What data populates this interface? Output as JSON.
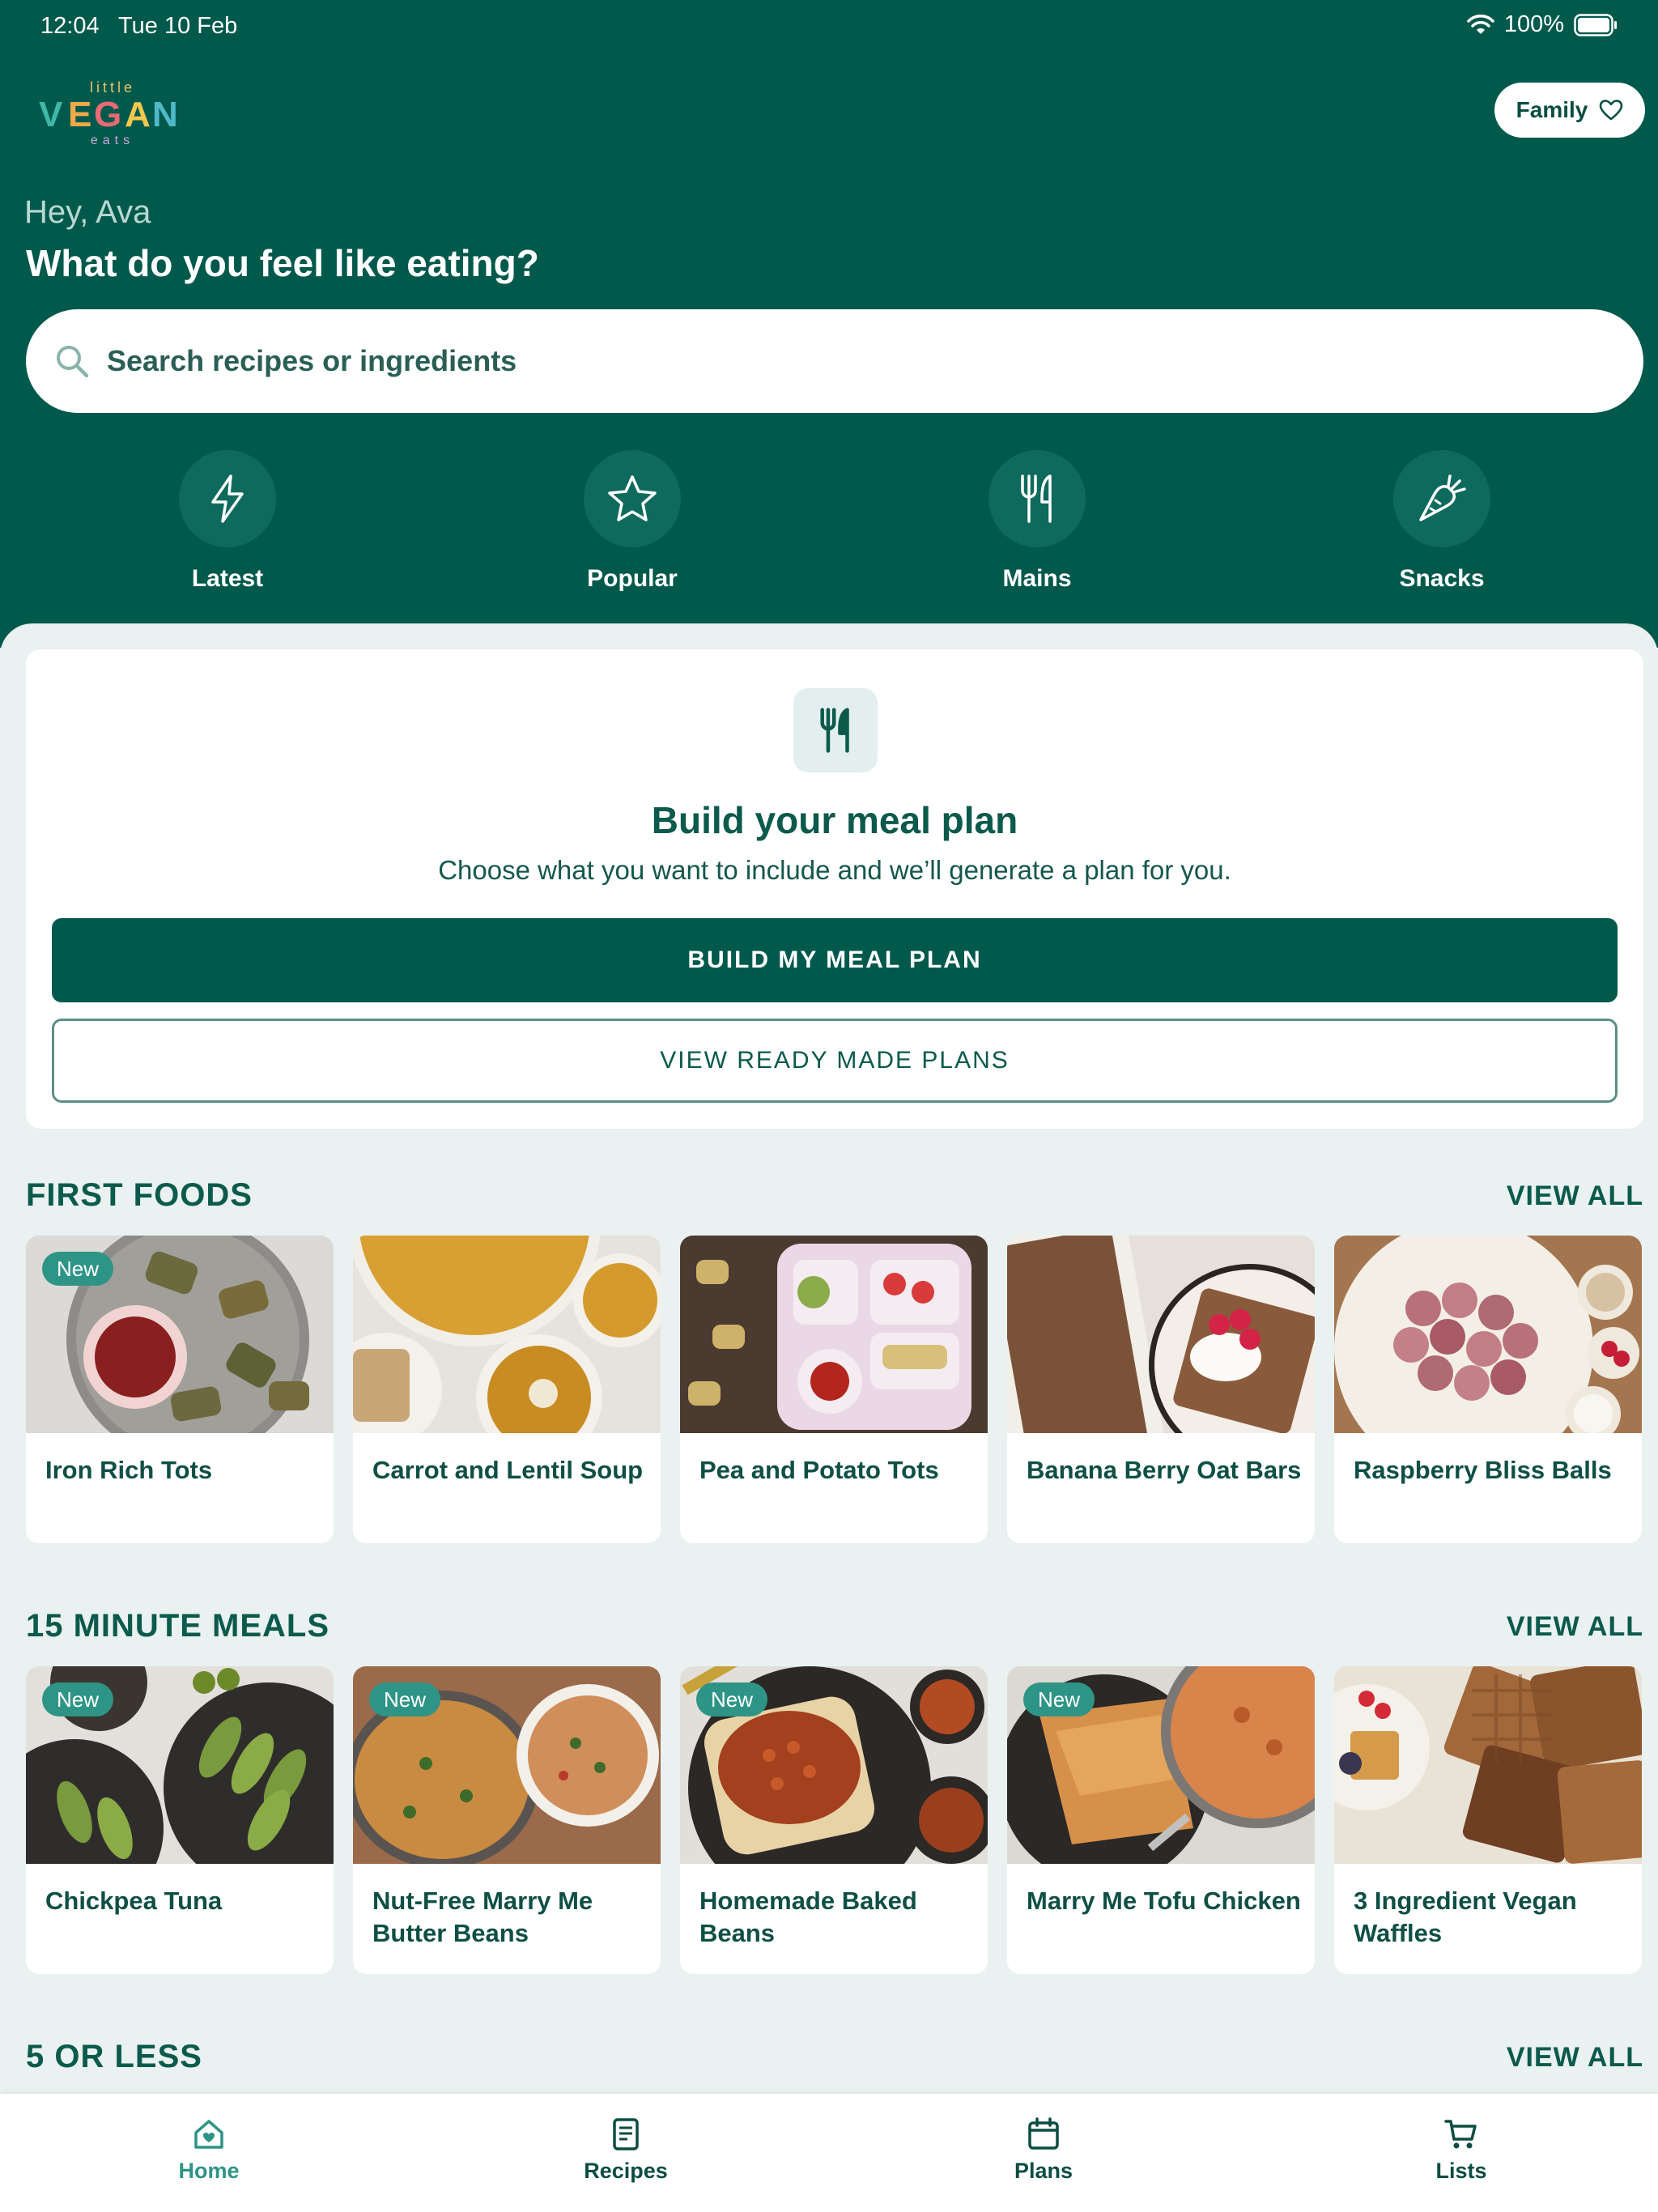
{
  "status_bar": {
    "time": "12:04",
    "date": "Tue 10 Feb",
    "battery": "100%"
  },
  "header": {
    "logo_text": [
      "little",
      "VEGAN",
      "eats"
    ],
    "profile_button": "Family",
    "greeting": "Hey, Ava",
    "question": "What do you feel like eating?"
  },
  "search": {
    "placeholder": "Search recipes or ingredients"
  },
  "categories": [
    {
      "label": "Latest",
      "icon": "bolt-icon"
    },
    {
      "label": "Popular",
      "icon": "star-icon"
    },
    {
      "label": "Mains",
      "icon": "cutlery-icon"
    },
    {
      "label": "Snacks",
      "icon": "carrot-icon"
    }
  ],
  "meal_plan": {
    "title": "Build your meal plan",
    "subtitle": "Choose what you want to include and we’ll generate a plan for you.",
    "primary_button": "BUILD MY MEAL PLAN",
    "secondary_button": "VIEW READY MADE PLANS"
  },
  "sections": [
    {
      "title": "FIRST FOODS",
      "view_all": "VIEW ALL",
      "items": [
        {
          "name": "Iron Rich Tots",
          "badge": "New"
        },
        {
          "name": "Carrot and Lentil Soup",
          "badge": ""
        },
        {
          "name": "Pea and Potato Tots",
          "badge": ""
        },
        {
          "name": "Banana Berry Oat Bars",
          "badge": ""
        },
        {
          "name": "Raspberry Bliss Balls",
          "badge": ""
        }
      ]
    },
    {
      "title": "15 MINUTE MEALS",
      "view_all": "VIEW ALL",
      "items": [
        {
          "name": "Chickpea Tuna",
          "badge": "New"
        },
        {
          "name": "Nut-Free Marry Me Butter Beans",
          "badge": "New"
        },
        {
          "name": "Homemade Baked Beans",
          "badge": "New"
        },
        {
          "name": "Marry Me Tofu Chicken",
          "badge": "New"
        },
        {
          "name": "3 Ingredient Vegan Waffles",
          "badge": ""
        }
      ]
    },
    {
      "title": "5 OR LESS",
      "view_all": "VIEW ALL",
      "items": []
    }
  ],
  "bottom_nav": [
    {
      "label": "Home",
      "icon": "home-icon",
      "active": true
    },
    {
      "label": "Recipes",
      "icon": "recipe-icon",
      "active": false
    },
    {
      "label": "Plans",
      "icon": "calendar-icon",
      "active": false
    },
    {
      "label": "Lists",
      "icon": "cart-icon",
      "active": false
    }
  ],
  "colors": {
    "brand": "#01594c",
    "accent": "#2e9486",
    "background": "#eaf1f1"
  }
}
